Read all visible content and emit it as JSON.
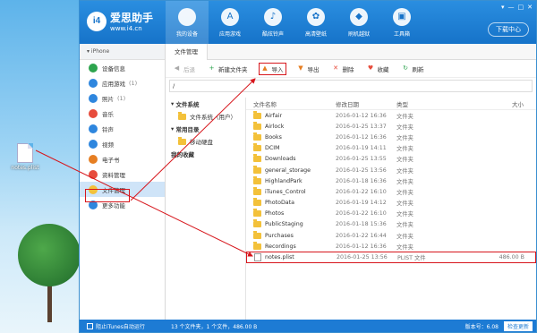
{
  "desktop": {
    "file_label": "notes.plist"
  },
  "app": {
    "logo_main": "爱思助手",
    "logo_sub": "www.i4.cn",
    "nav": [
      {
        "label": "我的设备",
        "icon": "apple-icon"
      },
      {
        "label": "应用游戏",
        "icon": "appstore-icon"
      },
      {
        "label": "酷炫铃声",
        "icon": "bell-icon"
      },
      {
        "label": "高清壁纸",
        "icon": "flower-icon"
      },
      {
        "label": "刷机越狱",
        "icon": "box-icon"
      },
      {
        "label": "工具箱",
        "icon": "toolbox-icon"
      }
    ],
    "window_controls": [
      "▾",
      "—",
      "□",
      "✕"
    ],
    "download_label": "下载中心"
  },
  "sidebar": {
    "device": "iPhone",
    "items": [
      {
        "label": "设备信息",
        "count": "",
        "color": "#2da44e",
        "icon": "info-icon"
      },
      {
        "label": "应用游戏",
        "count": "(1)",
        "color": "#2e86de",
        "icon": "app-icon"
      },
      {
        "label": "照片",
        "count": "(1)",
        "color": "#2e86de",
        "icon": "photo-icon"
      },
      {
        "label": "音乐",
        "count": "",
        "color": "#e74c3c",
        "icon": "music-icon"
      },
      {
        "label": "铃声",
        "count": "",
        "color": "#2e86de",
        "icon": "bell-icon"
      },
      {
        "label": "视频",
        "count": "",
        "color": "#2e86de",
        "icon": "video-icon"
      },
      {
        "label": "电子书",
        "count": "",
        "color": "#e67e22",
        "icon": "book-icon"
      },
      {
        "label": "资料管理",
        "count": "",
        "color": "#e74c3c",
        "icon": "data-icon"
      },
      {
        "label": "文件管理",
        "count": "",
        "color": "#f3c13a",
        "icon": "folder-icon"
      },
      {
        "label": "更多功能",
        "count": "",
        "color": "#2e86de",
        "icon": "more-icon"
      }
    ]
  },
  "main": {
    "tab": "文件管理",
    "toolbar": [
      {
        "label": "后退",
        "icon": "back-icon",
        "glyph": "◀",
        "color": "#aaa"
      },
      {
        "label": "新建文件夹",
        "icon": "new-folder-icon",
        "glyph": "+",
        "color": "#2da44e"
      },
      {
        "label": "导入",
        "icon": "import-icon",
        "glyph": "▲",
        "color": "#e67e22"
      },
      {
        "label": "导出",
        "icon": "export-icon",
        "glyph": "▼",
        "color": "#e67e22"
      },
      {
        "label": "删除",
        "icon": "delete-icon",
        "glyph": "✕",
        "color": "#e74c3c"
      },
      {
        "label": "收藏",
        "icon": "heart-icon",
        "glyph": "♥",
        "color": "#e74c3c"
      },
      {
        "label": "刷新",
        "icon": "refresh-icon",
        "glyph": "↻",
        "color": "#2da44e"
      }
    ],
    "path": "/",
    "tree": {
      "system_head": "文件系统",
      "system_child": "文件系统（用户）",
      "common_head": "常用目录",
      "common_child": "移动硬盘",
      "favorites": "我的收藏"
    },
    "columns": {
      "name": "文件名称",
      "date": "修改日期",
      "type": "类型",
      "size": "大小"
    },
    "files": [
      {
        "name": "Airfair",
        "date": "2016-01-12 16:36",
        "type": "文件夹",
        "size": ""
      },
      {
        "name": "Airlock",
        "date": "2016-01-25 13:37",
        "type": "文件夹",
        "size": ""
      },
      {
        "name": "Books",
        "date": "2016-01-12 16:36",
        "type": "文件夹",
        "size": ""
      },
      {
        "name": "DCIM",
        "date": "2016-01-19 14:11",
        "type": "文件夹",
        "size": ""
      },
      {
        "name": "Downloads",
        "date": "2016-01-25 13:55",
        "type": "文件夹",
        "size": ""
      },
      {
        "name": "general_storage",
        "date": "2016-01-25 13:56",
        "type": "文件夹",
        "size": ""
      },
      {
        "name": "HighlandPark",
        "date": "2016-01-18 16:36",
        "type": "文件夹",
        "size": ""
      },
      {
        "name": "iTunes_Control",
        "date": "2016-01-22 16:10",
        "type": "文件夹",
        "size": ""
      },
      {
        "name": "PhotoData",
        "date": "2016-01-19 14:12",
        "type": "文件夹",
        "size": ""
      },
      {
        "name": "Photos",
        "date": "2016-01-22 16:10",
        "type": "文件夹",
        "size": ""
      },
      {
        "name": "PublicStaging",
        "date": "2016-01-18 15:36",
        "type": "文件夹",
        "size": ""
      },
      {
        "name": "Purchases",
        "date": "2016-01-22 16:44",
        "type": "文件夹",
        "size": ""
      },
      {
        "name": "Recordings",
        "date": "2016-01-12 16:36",
        "type": "文件夹",
        "size": ""
      },
      {
        "name": "notes.plist",
        "date": "2016-01-25 13:56",
        "type": "PLIST 文件",
        "size": "486.00 B"
      }
    ]
  },
  "status": {
    "itunes": "阻止iTunes自动运行",
    "summary": "13 个文件夹，1 个文件，486.00 B",
    "version": "版本号：6.08",
    "check_update": "检查更新"
  },
  "colors": {
    "accent": "#1673c9",
    "highlight": "#d7161c",
    "selection": "#cfe4f8"
  }
}
